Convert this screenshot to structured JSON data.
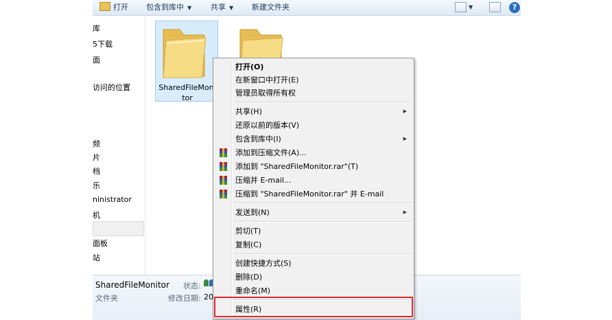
{
  "toolbar": {
    "open": "打开",
    "include_library": "包含到库中",
    "share": "共享",
    "new_folder": "新建文件夹"
  },
  "nav": {
    "items": [
      "库",
      "5下载",
      "面",
      "访问的位置",
      "频",
      "片",
      "档",
      "乐",
      "ninistrator",
      "机",
      "面板",
      "站"
    ]
  },
  "folders": [
    {
      "name_line1": "SharedFileMoni",
      "name_line2": "tor"
    }
  ],
  "details": {
    "name": "SharedFileMonitor",
    "type": "文件夹",
    "status_label": "状态:",
    "modified_label": "修改日期:",
    "modified_value": "201"
  },
  "menu": {
    "open": "打开(O)",
    "open_new_window": "在新窗口中打开(E)",
    "admin_ownership": "管理员取得所有权",
    "share": "共享(H)",
    "restore": "还原以前的版本(V)",
    "include_library": "包含到库中(I)",
    "add_archive": "添加到压缩文件(A)...",
    "add_rar": "添加到 \"SharedFileMonitor.rar\"(T)",
    "compress_email": "压缩并 E-mail...",
    "compress_rar_email": "压缩到 \"SharedFileMonitor.rar\" 并 E-mail",
    "send_to": "发送到(N)",
    "cut": "剪切(T)",
    "copy": "复制(C)",
    "create_shortcut": "创建快捷方式(S)",
    "delete": "删除(D)",
    "rename": "重命名(M)",
    "properties": "属性(R)",
    "submenu_arrow": "▶"
  },
  "colors": {
    "highlight_border": "#e0282e",
    "folder_selected_bg": "#d9ecfb",
    "menu_bg": "#f1f1f1"
  }
}
